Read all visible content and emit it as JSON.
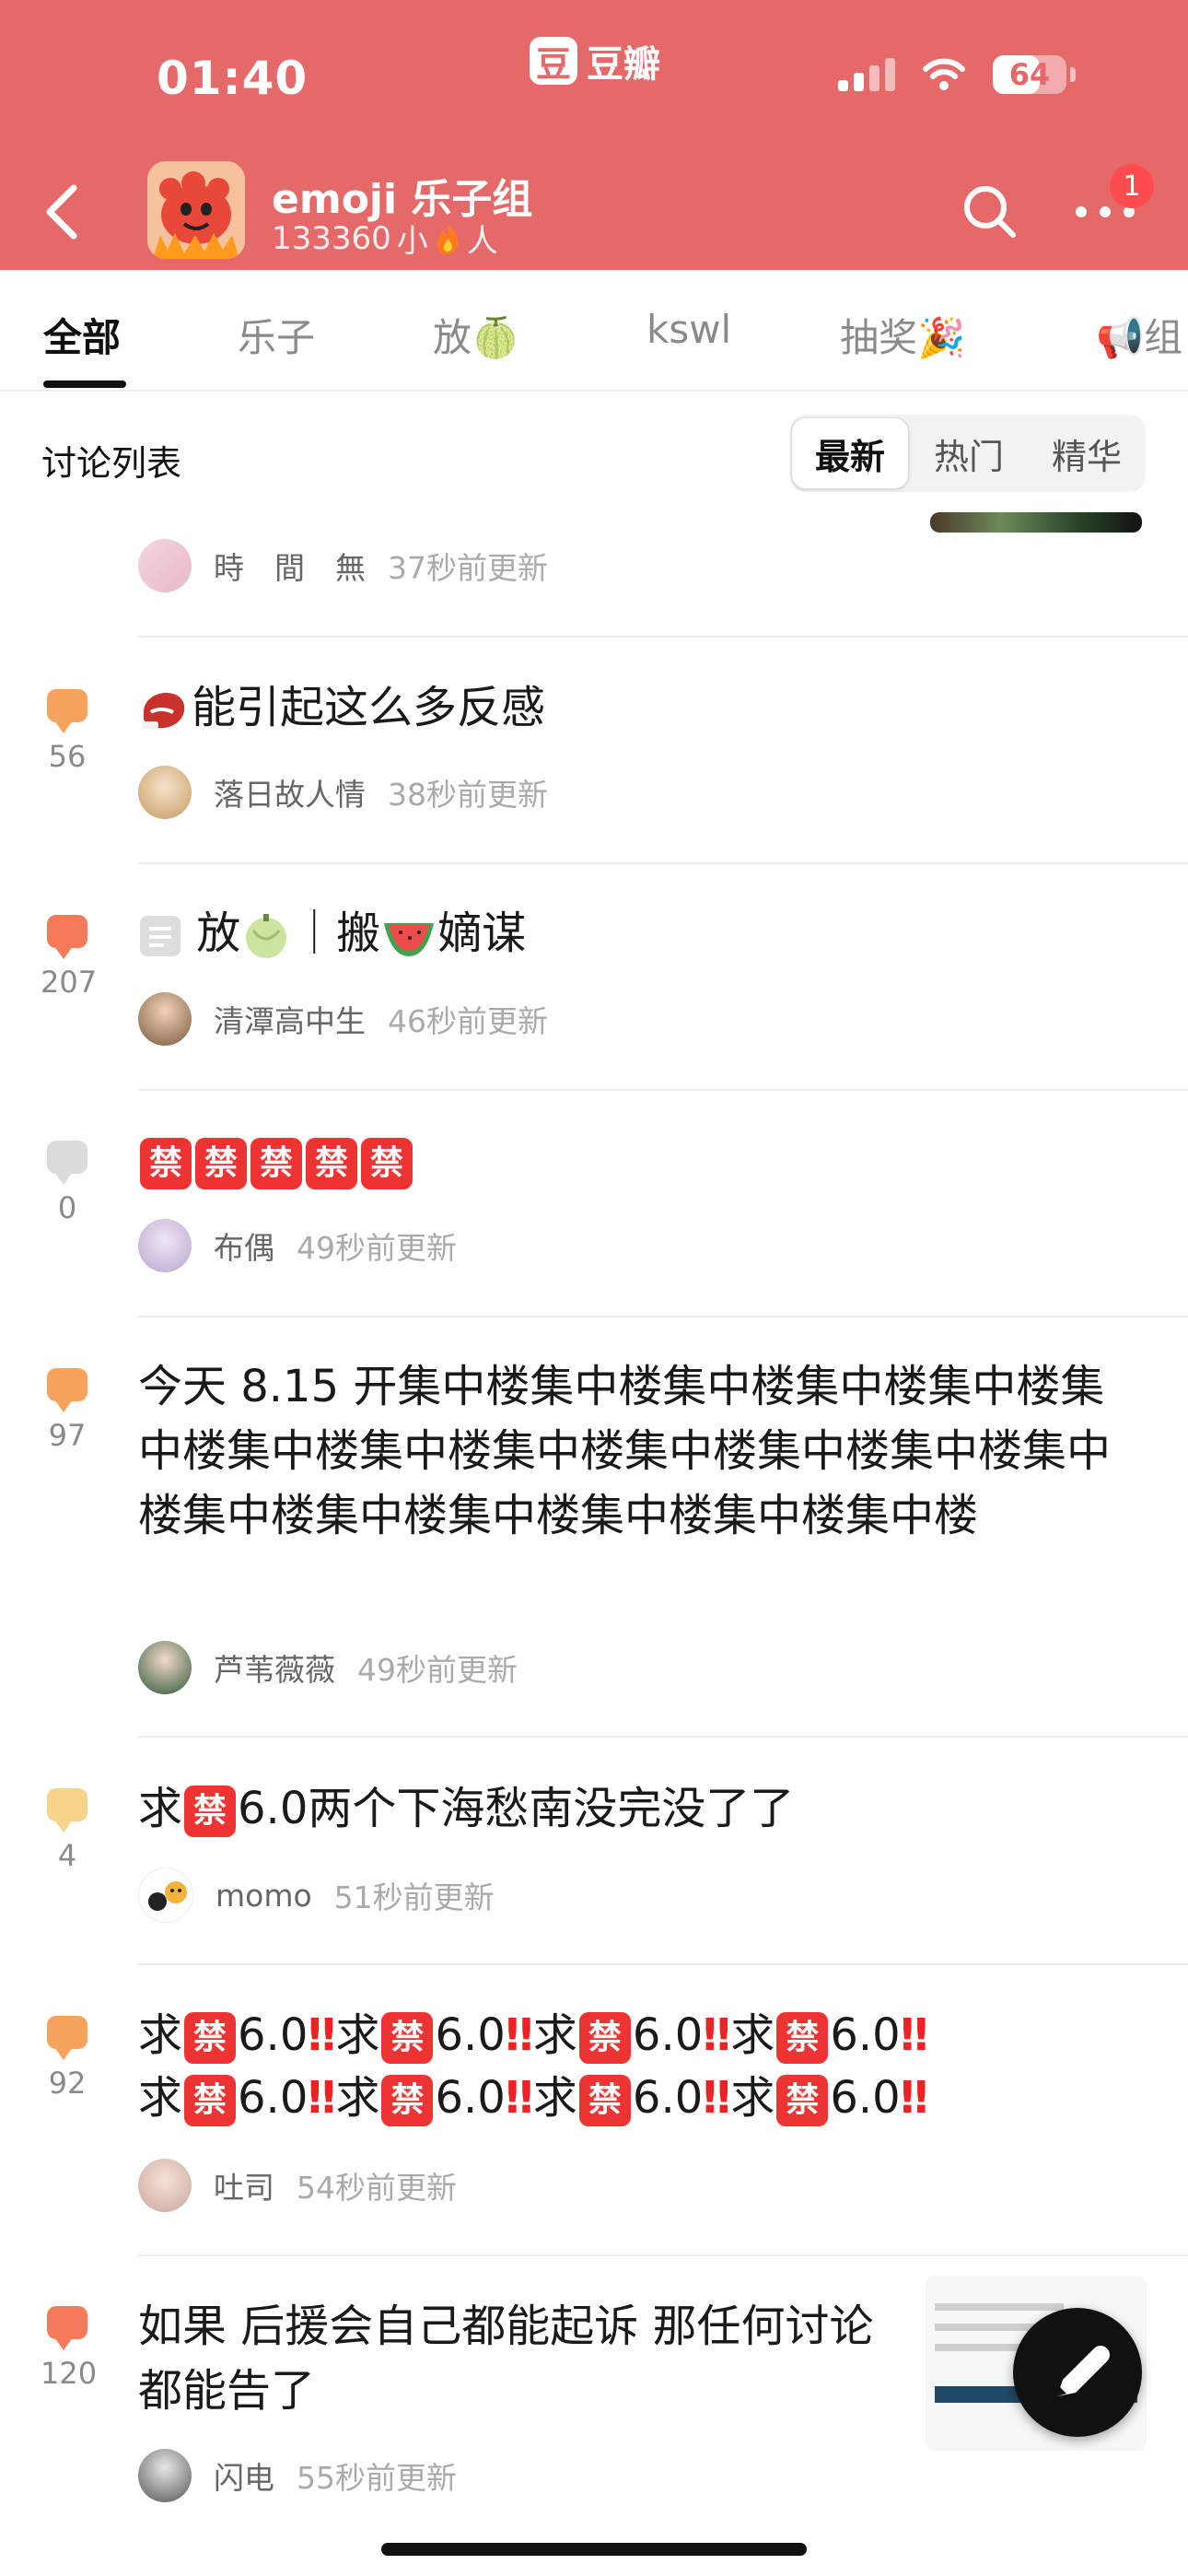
{
  "status_bar": {
    "time": "01:40",
    "app_logo": "豆",
    "app_name": "豆瓣",
    "battery": "64",
    "battery_level": 0.64
  },
  "header": {
    "group_name": "emoji 乐子组",
    "member_count": "133360",
    "member_suffix_pre": "小",
    "member_suffix_post": "人",
    "notification_count": "1"
  },
  "tabs": [
    "全部",
    "乐子",
    "放🍈",
    "kswl",
    "抽奖🎉",
    "📢组"
  ],
  "sort": {
    "title": "讨论列表",
    "options": [
      "最新",
      "热门",
      "精华"
    ],
    "selected": "最新"
  },
  "posts": [
    {
      "title": "",
      "author": "時　間　無",
      "time": "37秒前更新",
      "comments": ""
    },
    {
      "title": "能引起这么多反感",
      "author": "落日故人情",
      "time": "38秒前更新",
      "comments": "56"
    },
    {
      "title": "放",
      "title_mid": "｜搬",
      "title_end": "嫡谋",
      "author": "清潭高中生",
      "time": "46秒前更新",
      "comments": "207"
    },
    {
      "title": "禁",
      "author": "布偶",
      "time": "49秒前更新",
      "comments": "0"
    },
    {
      "title": "今天 8.15 开集中楼集中楼集中楼集中楼集中楼集中楼集中楼集中楼集中楼集中楼集中楼集中楼集中楼集中楼集中楼集中楼集中楼集中楼集中楼",
      "author": "芦苇薇薇",
      "time": "49秒前更新",
      "comments": "97"
    },
    {
      "title_pre": "求",
      "title_post": "6.0两个下海愁南没完没了了",
      "author": "momo",
      "time": "51秒前更新",
      "comments": "4"
    },
    {
      "title_pre": "求",
      "title_post": "6.0",
      "author": "吐司",
      "time": "54秒前更新",
      "comments": "92"
    },
    {
      "title": "如果 后援会自己都能起诉  那任何讨论都能告了",
      "author": "闪电",
      "time": "55秒前更新",
      "comments": "120"
    }
  ],
  "colors": {
    "header": "#e6696a",
    "bubble_hot": "#f47a5a",
    "bubble_warm": "#f7a35c",
    "bubble_light": "#f8d38a",
    "bubble_none": "#dcdcdc"
  },
  "icons": [
    "back-icon",
    "search-icon",
    "more-icon",
    "fire-icon",
    "comment-bubble-icon",
    "edit-pen-icon"
  ]
}
